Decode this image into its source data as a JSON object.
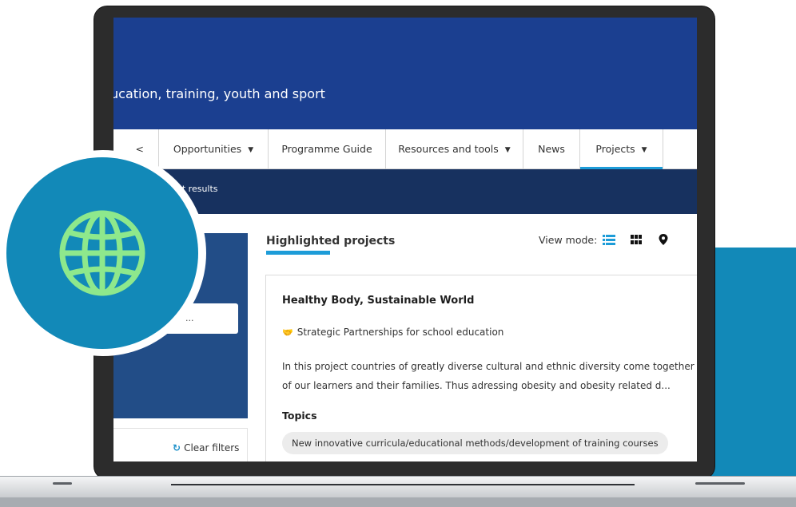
{
  "header": {
    "subtitle": "ucation, training, youth and sport"
  },
  "nav": {
    "items": [
      {
        "label": "Opportunities",
        "has_caret": true
      },
      {
        "label": "Programme Guide",
        "has_caret": false
      },
      {
        "label": "Resources and tools",
        "has_caret": true
      },
      {
        "label": "News",
        "has_caret": false
      },
      {
        "label": "Projects",
        "has_caret": true,
        "active": true
      }
    ],
    "partial_item": "<"
  },
  "breadcrumb": {
    "text": "ject results"
  },
  "filters": {
    "search_placeholder": "...",
    "clear_label": "Clear filters",
    "clear_icon": "refresh-icon"
  },
  "main": {
    "section_title": "Highlighted projects",
    "view_mode_label": "View mode:",
    "view_mode_icons": [
      "list-view-icon",
      "grid-view-icon",
      "map-pin-icon"
    ],
    "card": {
      "title": "Healthy Body, Sustainable World",
      "programme": "Strategic Partnerships for school education",
      "programme_icon": "handshake-icon",
      "description_line1": "In this project countries of greatly diverse cultural and ethnic diversity come together to",
      "description_line2": "of our learners and their families. Thus adressing obesity and obesity related d...",
      "topics_label": "Topics",
      "topics": [
        "New innovative curricula/educational methods/development of training courses"
      ]
    }
  },
  "badge": {
    "icon": "globe-icon"
  },
  "colors": {
    "header_blue": "#1b3f90",
    "nav_active": "#1d9cd8",
    "crumb_band": "#17315f",
    "filter_panel": "#224d87",
    "teal_accent": "#1289b8",
    "globe_green": "#8ee88c"
  }
}
